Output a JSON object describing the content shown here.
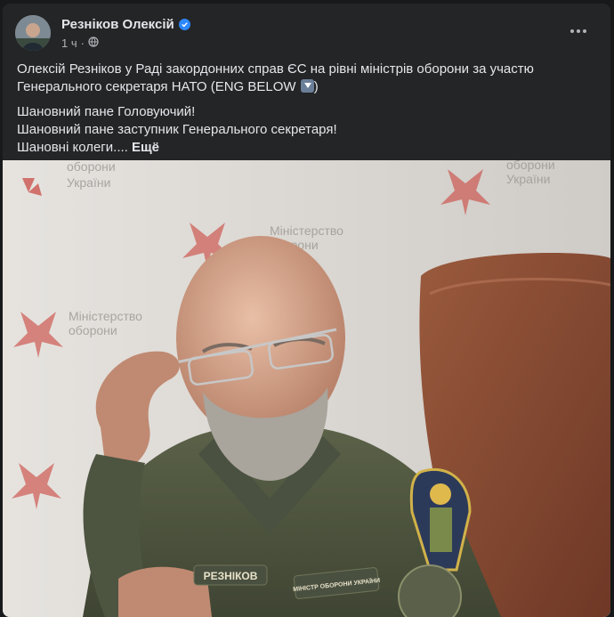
{
  "post": {
    "author": "Резніков Олексій",
    "time": "1 ч",
    "text_line1": "Олексій Резніков у Раді закордонних справ ЄС на рівні міністрів оборони за участю Генерального секретаря НАТО (ENG BELOW",
    "text_line1_end": ")",
    "text_line2": "Шановний пане Головуючий!",
    "text_line3": "Шановний пане заступник Генерального секретаря!",
    "text_line4": "Шановні колеги....",
    "see_more": "Ещё"
  },
  "photo": {
    "backdrop_text": [
      "Міністерство",
      "оборони",
      "України"
    ],
    "name_tag": "РЕЗНІКОВ",
    "ministry_tag": "МІНІСТР ОБОРОНИ УКРАЇНИ"
  },
  "icons": {
    "verified": "verified-badge-icon",
    "audience": "globe-icon",
    "menu": "more-options-icon",
    "emoji": "down-arrow-emoji-icon"
  },
  "colors": {
    "background": "#18191a",
    "card": "#242526",
    "text": "#e4e6eb",
    "secondary_text": "#b0b3b8",
    "verified": "#2d88ff"
  }
}
